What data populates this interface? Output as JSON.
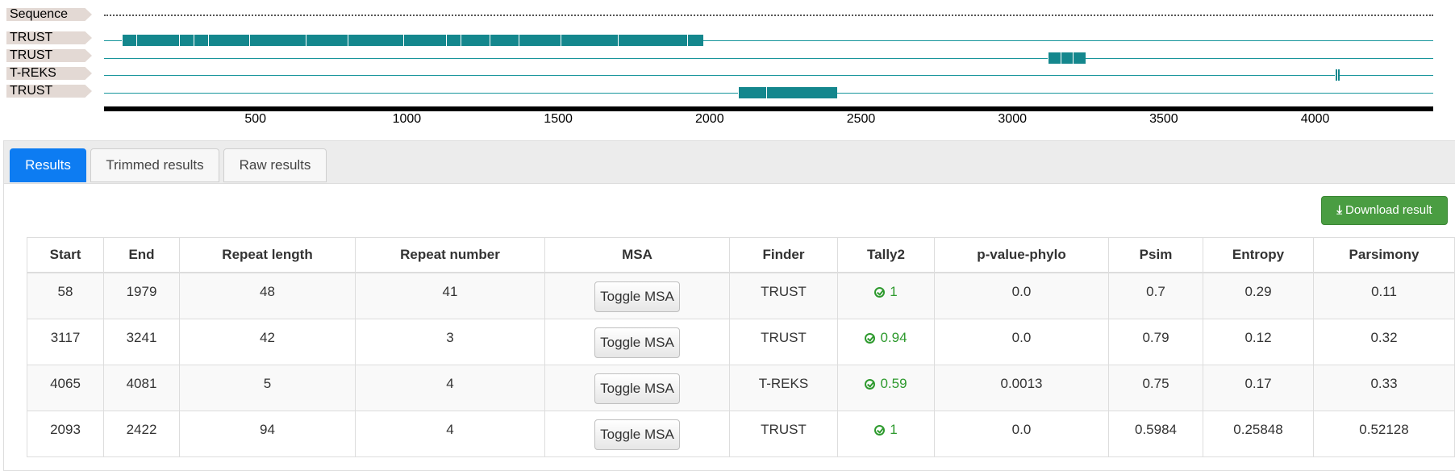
{
  "viewer": {
    "axis": {
      "min": 0,
      "max": 4390,
      "ticks": [
        500,
        1000,
        1500,
        2000,
        2500,
        3000,
        3500,
        4000
      ]
    },
    "tracks": [
      {
        "label": "Sequence",
        "style": "dotted",
        "segments": []
      },
      {
        "label": "TRUST",
        "style": "line",
        "segments": [
          [
            58,
            106
          ],
          [
            106,
            247
          ],
          [
            247,
            295
          ],
          [
            295,
            343
          ],
          [
            343,
            479
          ],
          [
            479,
            667
          ],
          [
            667,
            805
          ],
          [
            805,
            989
          ],
          [
            989,
            1130
          ],
          [
            1130,
            1178
          ],
          [
            1178,
            1274
          ],
          [
            1274,
            1370
          ],
          [
            1370,
            1508
          ],
          [
            1508,
            1696
          ],
          [
            1696,
            1927
          ],
          [
            1927,
            1979
          ]
        ]
      },
      {
        "label": "TRUST",
        "style": "line",
        "segments": [
          [
            3117,
            3159
          ],
          [
            3159,
            3200
          ],
          [
            3200,
            3241
          ]
        ]
      },
      {
        "label": "T-REKS",
        "style": "line",
        "segments": [
          [
            4065,
            4073
          ],
          [
            4073,
            4081
          ]
        ]
      },
      {
        "label": "TRUST",
        "style": "line",
        "segments": [
          [
            2093,
            2186
          ],
          [
            2186,
            2422
          ]
        ]
      }
    ],
    "color": "#14878d"
  },
  "tabs": [
    {
      "label": "Results",
      "active": true
    },
    {
      "label": "Trimmed results",
      "active": false
    },
    {
      "label": "Raw results",
      "active": false
    }
  ],
  "download_button": {
    "label": "Download result",
    "icon": "download-icon"
  },
  "table": {
    "headers": [
      "Start",
      "End",
      "Repeat length",
      "Repeat number",
      "MSA",
      "Finder",
      "Tally2",
      "p-value-phylo",
      "Psim",
      "Entropy",
      "Parsimony"
    ],
    "rows": [
      {
        "start": "58",
        "end": "1979",
        "repeat_length": "48",
        "repeat_number": "41",
        "msa": "Toggle MSA",
        "finder": "TRUST",
        "tally2": "1",
        "pvalue": "0.0",
        "psim": "0.7",
        "entropy": "0.29",
        "parsimony": "0.11"
      },
      {
        "start": "3117",
        "end": "3241",
        "repeat_length": "42",
        "repeat_number": "3",
        "msa": "Toggle MSA",
        "finder": "TRUST",
        "tally2": "0.94",
        "pvalue": "0.0",
        "psim": "0.79",
        "entropy": "0.12",
        "parsimony": "0.32"
      },
      {
        "start": "4065",
        "end": "4081",
        "repeat_length": "5",
        "repeat_number": "4",
        "msa": "Toggle MSA",
        "finder": "T-REKS",
        "tally2": "0.59",
        "pvalue": "0.0013",
        "psim": "0.75",
        "entropy": "0.17",
        "parsimony": "0.33"
      },
      {
        "start": "2093",
        "end": "2422",
        "repeat_length": "94",
        "repeat_number": "4",
        "msa": "Toggle MSA",
        "finder": "TRUST",
        "tally2": "1",
        "pvalue": "0.0",
        "psim": "0.5984",
        "entropy": "0.25848",
        "parsimony": "0.52128"
      }
    ],
    "tally_color": "#2e9a2e"
  }
}
